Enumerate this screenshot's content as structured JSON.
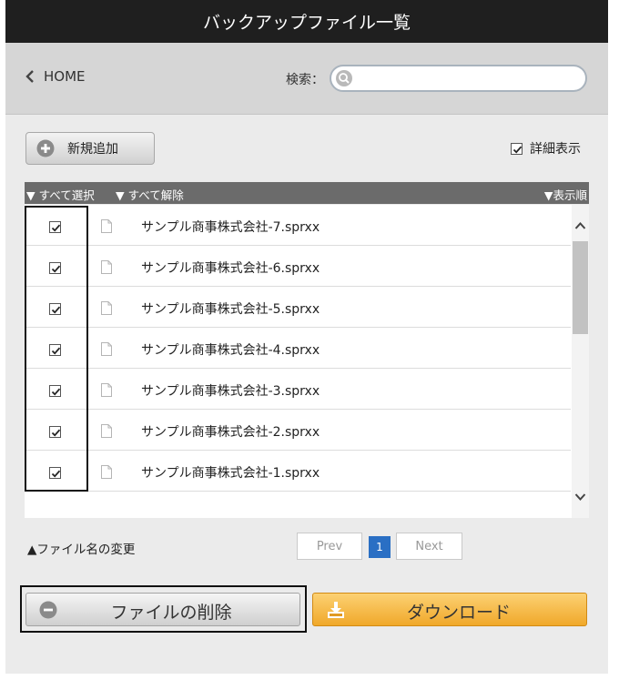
{
  "header": {
    "title": "バックアップファイル一覧"
  },
  "nav": {
    "home_label": "HOME",
    "search_label": "検索：",
    "search_placeholder": "",
    "search_value": ""
  },
  "toolbar": {
    "add_label": "新規追加",
    "detail_label": "詳細表示",
    "detail_checked": true
  },
  "list_header": {
    "select_all": "▼ すべて選択",
    "deselect_all": "▼ すべて解除",
    "sort": "▼表示順"
  },
  "files": [
    {
      "name": "サンプル商事株式会社-7.sprxx",
      "checked": true
    },
    {
      "name": "サンプル商事株式会社-6.sprxx",
      "checked": true
    },
    {
      "name": "サンプル商事株式会社-5.sprxx",
      "checked": true
    },
    {
      "name": "サンプル商事株式会社-4.sprxx",
      "checked": true
    },
    {
      "name": "サンプル商事株式会社-3.sprxx",
      "checked": true
    },
    {
      "name": "サンプル商事株式会社-2.sprxx",
      "checked": true
    },
    {
      "name": "サンプル商事株式会社-1.sprxx",
      "checked": true
    }
  ],
  "footer": {
    "rename_label": "▲ファイル名の変更"
  },
  "pagination": {
    "prev": "Prev",
    "current": "1",
    "next": "Next"
  },
  "actions": {
    "delete_label": "ファイルの削除",
    "download_label": "ダウンロード"
  },
  "colors": {
    "header_bg": "#1f1f1f",
    "page_current": "#2a6fc4",
    "download_bg": "#f5b84a"
  }
}
